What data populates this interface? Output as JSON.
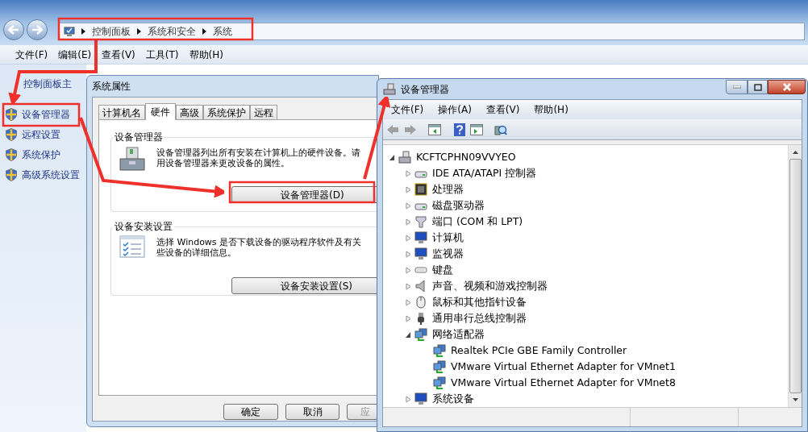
{
  "explorer": {
    "breadcrumb": [
      "控制面板",
      "系统和安全",
      "系统"
    ],
    "menu": [
      "文件(F)",
      "编辑(E)",
      "查看(V)",
      "工具(T)",
      "帮助(H)"
    ],
    "sidebar": {
      "home": "控制面板主",
      "links": [
        {
          "label": "设备管理器"
        },
        {
          "label": "远程设置"
        },
        {
          "label": "系统保护"
        },
        {
          "label": "高级系统设置"
        }
      ]
    }
  },
  "system_properties": {
    "title": "系统属性",
    "tabs": [
      {
        "label": "计算机名",
        "selected": false
      },
      {
        "label": "硬件",
        "selected": true
      },
      {
        "label": "高级",
        "selected": false
      },
      {
        "label": "系统保护",
        "selected": false
      },
      {
        "label": "远程",
        "selected": false
      }
    ],
    "groups": [
      {
        "kind": "devices",
        "title": "设备管理器",
        "lines": [
          "设备管理器列出所有安装在计算机上的硬件设备。请",
          "用设备管理器来更改设备的属性。"
        ],
        "button": "设备管理器(D)"
      },
      {
        "kind": "install",
        "title": "设备安装设置",
        "lines": [
          "选择 Windows 是否下载设备的驱动程序软件及有关",
          "些设备的详细信息。"
        ],
        "button": "设备安装设置(S)"
      }
    ],
    "buttons": [
      "确定",
      "取消",
      "应"
    ]
  },
  "device_manager": {
    "title": "设备管理器",
    "menu": [
      "文件(F)",
      "操作(A)",
      "查看(V)",
      "帮助(H)"
    ],
    "tree": {
      "label": "KCFTCPHN09VVYEO",
      "kind": "computer",
      "expanded": true,
      "children": [
        {
          "label": "IDE ATA/ATAPI 控制器",
          "kind": "drive",
          "expanded": false
        },
        {
          "label": "处理器",
          "kind": "chip",
          "expanded": false
        },
        {
          "label": "磁盘驱动器",
          "kind": "drive",
          "expanded": false
        },
        {
          "label": "端口 (COM 和 LPT)",
          "kind": "port",
          "expanded": false
        },
        {
          "label": "计算机",
          "kind": "monitor",
          "expanded": false
        },
        {
          "label": "监视器",
          "kind": "monitor",
          "expanded": false
        },
        {
          "label": "键盘",
          "kind": "keyboard",
          "expanded": false
        },
        {
          "label": "声音、视频和游戏控制器",
          "kind": "speaker",
          "expanded": false
        },
        {
          "label": "鼠标和其他指针设备",
          "kind": "mouse",
          "expanded": false
        },
        {
          "label": "通用串行总线控制器",
          "kind": "usb",
          "expanded": false
        },
        {
          "label": "网络适配器",
          "kind": "network",
          "expanded": true,
          "children": [
            {
              "label": "Realtek PCIe GBE Family Controller",
              "kind": "network"
            },
            {
              "label": "VMware Virtual Ethernet Adapter for VMnet1",
              "kind": "network"
            },
            {
              "label": "VMware Virtual Ethernet Adapter for VMnet8",
              "kind": "network"
            }
          ]
        },
        {
          "label": "系统设备",
          "kind": "monitor",
          "expanded": false
        }
      ]
    }
  }
}
